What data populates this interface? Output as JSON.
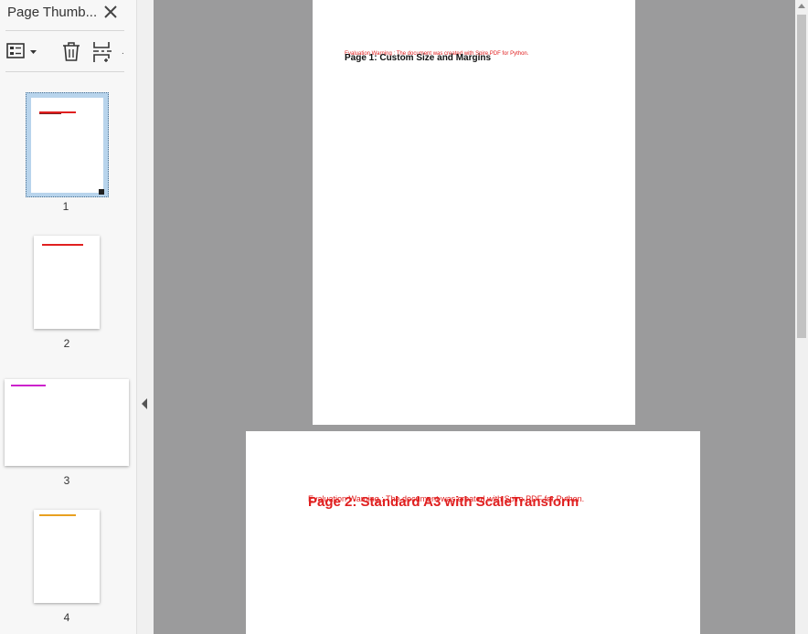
{
  "sidebar": {
    "title": "Page Thumb...",
    "close_icon": "close-icon",
    "toolbar": {
      "options_icon": "thumbnail-options-icon",
      "delete_icon": "trash-icon",
      "insert_icon": "insert-page-icon",
      "more": "."
    },
    "thumbnails": [
      {
        "number": "1",
        "selected": true,
        "mark_color": "#e02020"
      },
      {
        "number": "2",
        "selected": false,
        "mark_color": "#e02020"
      },
      {
        "number": "3",
        "selected": false,
        "mark_color": "#cc22cc"
      },
      {
        "number": "4",
        "selected": false,
        "mark_color": "#e8a020"
      }
    ]
  },
  "document": {
    "page1": {
      "watermark": "Evaluation Warning : The document was created with Spire.PDF for Python.",
      "title": "Page 1: Custom Size and Margins"
    },
    "page2": {
      "watermark": "Evaluation Warning : The document was created with Spire.PDF for Python.",
      "title": "Page 2: Standard A3 with ScaleTransform"
    }
  },
  "colors": {
    "doc_background": "#9b9b9c",
    "selection": "#b8d4ec",
    "warning_red": "#e02020"
  }
}
